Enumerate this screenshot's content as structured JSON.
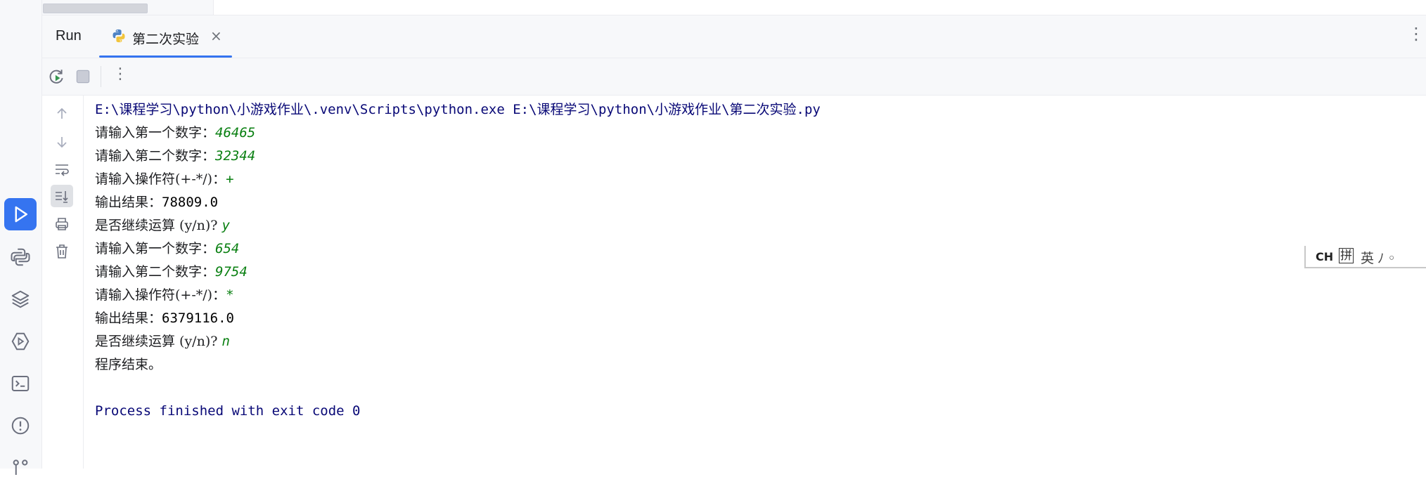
{
  "tool_window": {
    "title": "Run",
    "tab_label": "第二次实验",
    "tab_close": "×",
    "more": "⋮"
  },
  "toolbar": {
    "more": "⋮"
  },
  "console": {
    "cmd": "E:\\课程学习\\python\\小游戏作业\\.venv\\Scripts\\python.exe E:\\课程学习\\python\\小游戏作业\\第二次实验.py",
    "lines": [
      {
        "prompt": "请输入第一个数字：",
        "value": "46465"
      },
      {
        "prompt": "请输入第二个数字：",
        "value": "32344"
      },
      {
        "prompt": "请输入操作符(+-*/)：",
        "value": "+"
      },
      {
        "prompt": "输出结果：",
        "value": "78809.0"
      },
      {
        "prompt": "是否继续运算 (y/n)? ",
        "value": "y"
      },
      {
        "prompt": "请输入第一个数字：",
        "value": "654"
      },
      {
        "prompt": "请输入第二个数字：",
        "value": "9754"
      },
      {
        "prompt": "请输入操作符(+-*/)：",
        "value": "*"
      },
      {
        "prompt": "输出结果：",
        "value": "6379116.0"
      },
      {
        "prompt": "是否继续运算 (y/n)? ",
        "value": "n"
      }
    ],
    "end_text": "程序结束。",
    "process_text": "Process finished with exit code 0"
  },
  "ime": {
    "ch_label": "CH",
    "pinyin_label": "拼",
    "extra": "英ﾉ◦"
  },
  "colors": {
    "accent": "#3574f0",
    "input_green": "#087f10",
    "path_navy": "#080876"
  }
}
